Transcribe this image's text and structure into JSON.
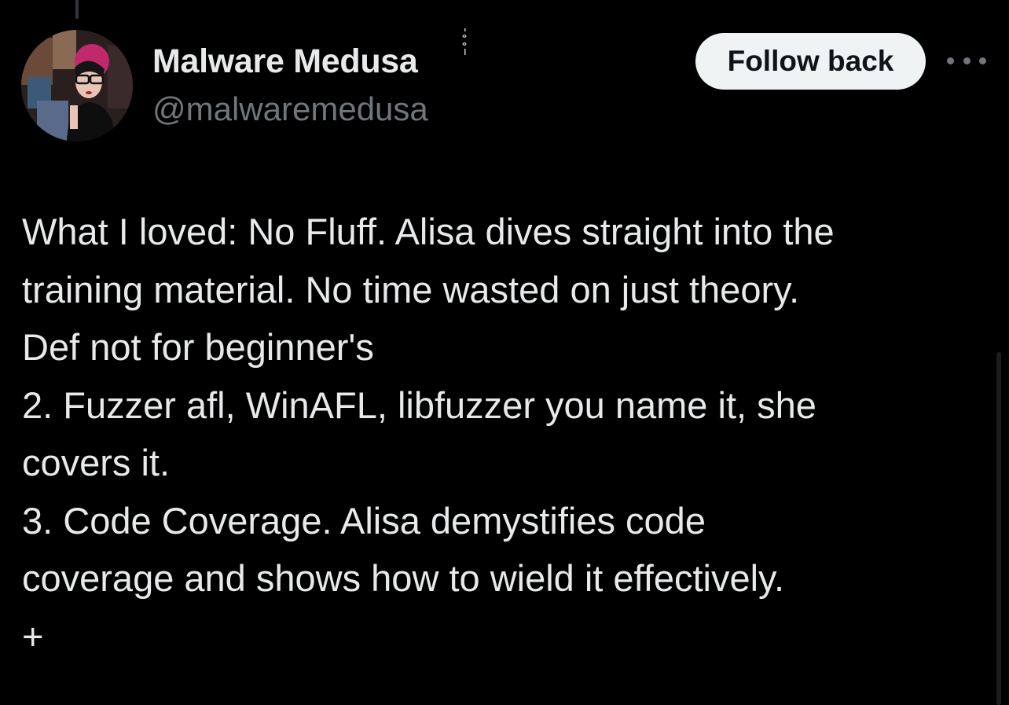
{
  "author": {
    "display_name": "Malware Medusa",
    "handle": "@malwaremedusa",
    "avatar_icon": "profile-photo"
  },
  "actions": {
    "follow_label": "Follow back",
    "more_icon": "more-horizontal-icon"
  },
  "tweet": {
    "lines": [
      "What I loved: No Fluff. Alisa dives straight into the",
      "training material. No time wasted on just theory.",
      "Def not for beginner's",
      "2. Fuzzer afl, WinAFL, libfuzzer you name it, she",
      "covers it.",
      "3. Code Coverage. Alisa demystifies code",
      "coverage and shows how to wield it effectively.",
      "+"
    ]
  },
  "colors": {
    "background": "#000000",
    "primary_text": "#e7e9ea",
    "secondary_text": "#71767b",
    "button_bg": "#eff3f4",
    "button_text": "#0f1419"
  }
}
